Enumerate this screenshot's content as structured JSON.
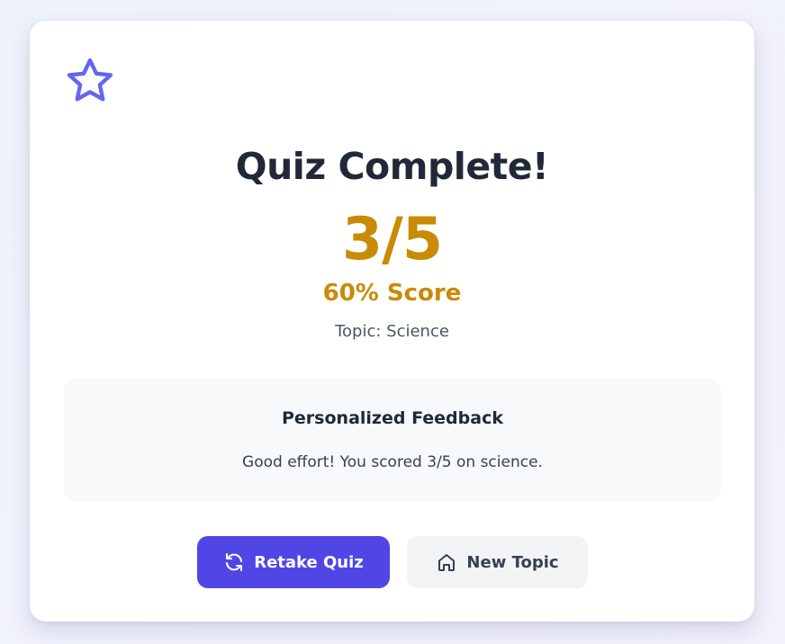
{
  "result": {
    "title": "Quiz Complete!",
    "score": "3/5",
    "percent_label": "60% Score",
    "topic_label": "Topic: Science"
  },
  "feedback": {
    "heading": "Personalized Feedback",
    "message": "Good effort! You scored 3/5 on science."
  },
  "actions": {
    "retake_label": "Retake Quiz",
    "new_topic_label": "New Topic"
  },
  "icons": {
    "badge": "star-icon",
    "retake": "refresh-icon",
    "new_topic": "home-icon"
  },
  "colors": {
    "accent": "#4f46e5",
    "score": "#ca8a04",
    "title": "#1f2937"
  }
}
